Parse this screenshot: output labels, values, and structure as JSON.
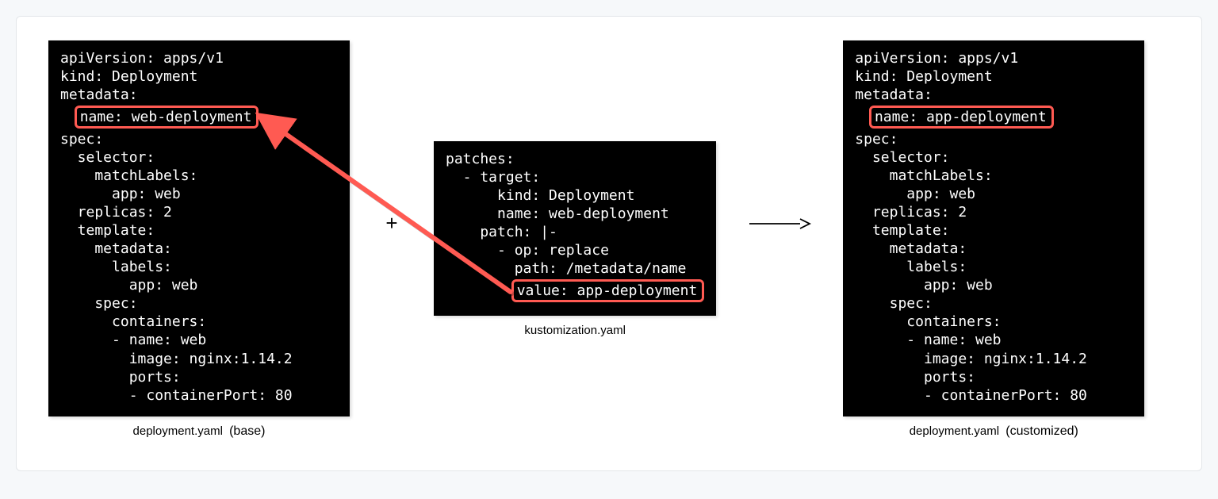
{
  "left": {
    "caption_file": "deployment.yaml",
    "caption_note": "(base)",
    "lines": [
      "apiVersion: apps/v1",
      "kind: Deployment",
      "metadata:"
    ],
    "highlight_indent": "  ",
    "highlight": "name: web-deployment",
    "lines_after": [
      "spec:",
      "  selector:",
      "    matchLabels:",
      "      app: web",
      "  replicas: 2",
      "  template:",
      "    metadata:",
      "      labels:",
      "        app: web",
      "    spec:",
      "      containers:",
      "      - name: web",
      "        image: nginx:1.14.2",
      "        ports:",
      "        - containerPort: 80"
    ]
  },
  "middle": {
    "caption_file": "kustomization.yaml",
    "lines": [
      "patches:",
      "  - target:",
      "      kind: Deployment",
      "      name: web-deployment",
      "    patch: |-",
      "      - op: replace",
      "        path: /metadata/name"
    ],
    "highlight_indent": "        ",
    "highlight": "value: app-deployment"
  },
  "right": {
    "caption_file": "deployment.yaml",
    "caption_note": "(customized)",
    "lines": [
      "apiVersion: apps/v1",
      "kind: Deployment",
      "metadata:"
    ],
    "highlight_indent": "  ",
    "highlight": "name: app-deployment",
    "lines_after": [
      "spec:",
      "  selector:",
      "    matchLabels:",
      "      app: web",
      "  replicas: 2",
      "  template:",
      "    metadata:",
      "      labels:",
      "        app: web",
      "    spec:",
      "      containers:",
      "      - name: web",
      "        image: nginx:1.14.2",
      "        ports:",
      "        - containerPort: 80"
    ]
  },
  "symbols": {
    "plus": "+",
    "arrow_alt": "→"
  }
}
